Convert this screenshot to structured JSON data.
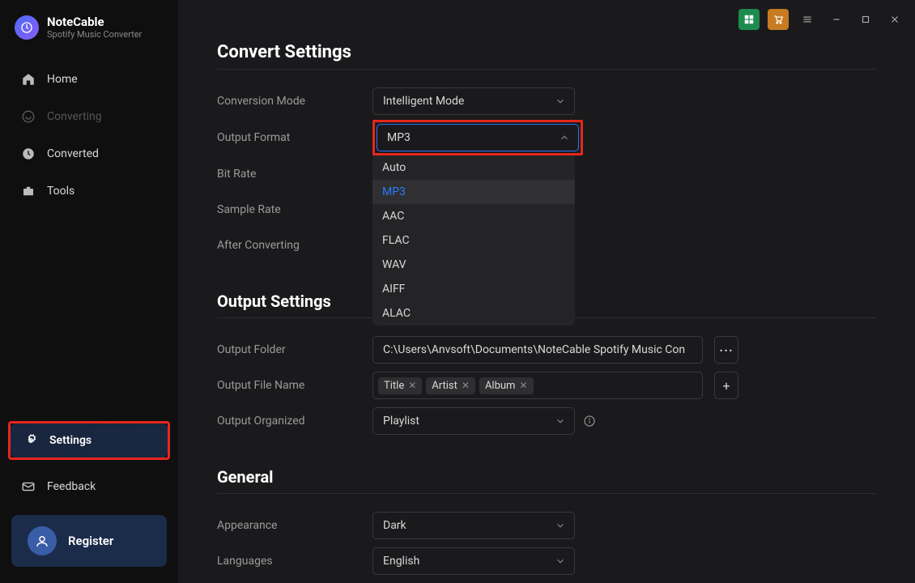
{
  "app": {
    "title": "NoteCable",
    "subtitle": "Spotify Music Converter"
  },
  "sidebar": {
    "items": [
      {
        "label": "Home"
      },
      {
        "label": "Converting"
      },
      {
        "label": "Converted"
      },
      {
        "label": "Tools"
      }
    ],
    "settings": "Settings",
    "feedback": "Feedback",
    "register": "Register"
  },
  "convert_settings": {
    "title": "Convert Settings",
    "conversion_mode": {
      "label": "Conversion Mode",
      "value": "Intelligent Mode"
    },
    "output_format": {
      "label": "Output Format",
      "value": "MP3",
      "options": [
        "Auto",
        "MP3",
        "AAC",
        "FLAC",
        "WAV",
        "AIFF",
        "ALAC"
      ]
    },
    "bit_rate": {
      "label": "Bit Rate"
    },
    "sample_rate": {
      "label": "Sample Rate"
    },
    "after_converting": {
      "label": "After Converting"
    }
  },
  "output_settings": {
    "title": "Output Settings",
    "output_folder": {
      "label": "Output Folder",
      "value": "C:\\Users\\Anvsoft\\Documents\\NoteCable Spotify Music Con"
    },
    "output_file_name": {
      "label": "Output File Name",
      "tags": [
        "Title",
        "Artist",
        "Album"
      ]
    },
    "output_organized": {
      "label": "Output Organized",
      "value": "Playlist"
    }
  },
  "general": {
    "title": "General",
    "appearance": {
      "label": "Appearance",
      "value": "Dark"
    },
    "languages": {
      "label": "Languages",
      "value": "English"
    }
  }
}
